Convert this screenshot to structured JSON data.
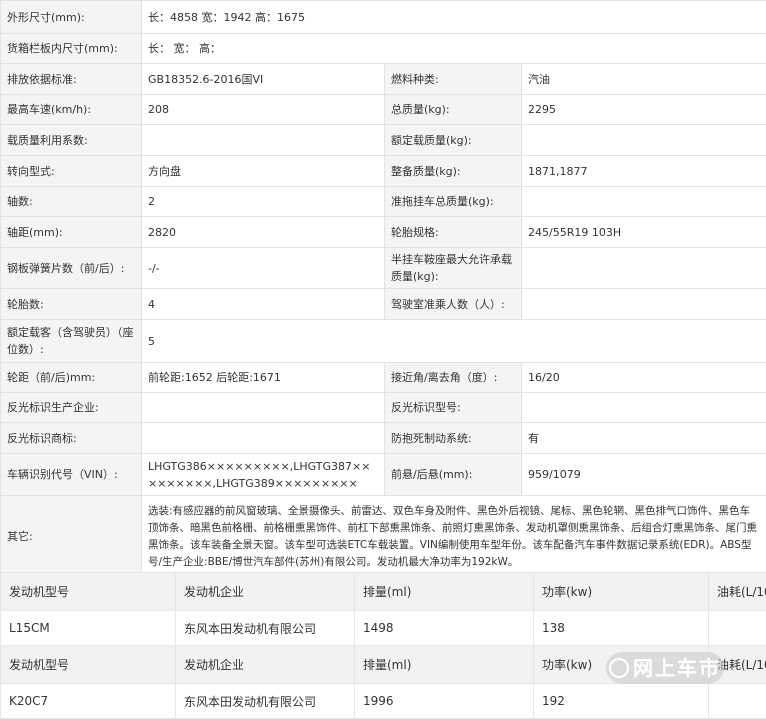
{
  "spec": {
    "r1": {
      "label": "外形尺寸(mm):",
      "value": "长：4858 宽：1942 高：1675"
    },
    "r2": {
      "label": "货箱栏板内尺寸(mm):",
      "value": "长： 宽： 高："
    },
    "r3": {
      "l1": "排放依据标准:",
      "v1": "GB18352.6-2016国VI",
      "l2": "燃料种类:",
      "v2": "汽油"
    },
    "r4": {
      "l1": "最高车速(km/h):",
      "v1": "208",
      "l2": "总质量(kg):",
      "v2": "2295"
    },
    "r5": {
      "l1": "载质量利用系数:",
      "v1": "",
      "l2": "额定载质量(kg):",
      "v2": ""
    },
    "r6": {
      "l1": "转向型式:",
      "v1": "方向盘",
      "l2": "整备质量(kg):",
      "v2": "1871,1877"
    },
    "r7": {
      "l1": "轴数:",
      "v1": "2",
      "l2": "准拖挂车总质量(kg):",
      "v2": ""
    },
    "r8": {
      "l1": "轴距(mm):",
      "v1": "2820",
      "l2": "轮胎规格:",
      "v2": "245/55R19 103H"
    },
    "r9": {
      "l1": "钢板弹簧片数（前/后）:",
      "v1": "-/-",
      "l2": "半挂车鞍座最大允许承载质量(kg):",
      "v2": ""
    },
    "r10": {
      "l1": "轮胎数:",
      "v1": "4",
      "l2": "驾驶室准乘人数（人）:",
      "v2": ""
    },
    "r11": {
      "label": "额定载客（含驾驶员）（座位数）:",
      "value": "5"
    },
    "r12": {
      "l1": "轮距（前/后)mm:",
      "v1": "前轮距:1652 后轮距:1671",
      "l2": "接近角/离去角（度）:",
      "v2": "16/20"
    },
    "r13": {
      "l1": "反光标识生产企业:",
      "v1": "",
      "l2": "反光标识型号:",
      "v2": ""
    },
    "r14": {
      "l1": "反光标识商标:",
      "v1": "",
      "l2": "防抱死制动系统:",
      "v2": "有"
    },
    "r15": {
      "l1": "车辆识别代号（VIN）:",
      "v1": "LHGTG386×××××××××,LHGTG387×××××××××,LHGTG389×××××××××",
      "l2": "前悬/后悬(mm):",
      "v2": "959/1079"
    },
    "r16": {
      "label": "其它:",
      "value": "选装:有感应器的前风窗玻璃、全景摄像头、前雷达、双色车身及附件、黑色外后视镜、尾标、黑色轮辋、黑色排气口饰件、黑色车顶饰条、暗黑色前格栅、前格栅熏黑饰件、前杠下部熏黑饰条、前照灯熏黑饰条、发动机罩侧熏黑饰条、后组合灯熏黑饰条、尾门熏黑饰条。该车装备全景天窗。该车型可选装ETC车载装置。VIN编制使用车型年份。该车配备汽车事件数据记录系统(EDR)。ABS型号/生产企业:BBE/博世汽车部件(苏州)有限公司。发动机最大净功率为192kW。"
    }
  },
  "engine_header": [
    "发动机型号",
    "发动机企业",
    "排量(ml)",
    "功率(kw)",
    "油耗(L/10"
  ],
  "engines": [
    {
      "model": "L15CM",
      "maker": "东风本田发动机有限公司",
      "displacement": "1498",
      "power": "138",
      "fuel": ""
    },
    {
      "model": "K20C7",
      "maker": "东风本田发动机有限公司",
      "displacement": "1996",
      "power": "192",
      "fuel": ""
    }
  ],
  "watermark": "网上车市",
  "colors": {
    "label_bg": "#f4f4f4",
    "border": "#e2e2e2",
    "header_bg": "#f2f2f2"
  }
}
